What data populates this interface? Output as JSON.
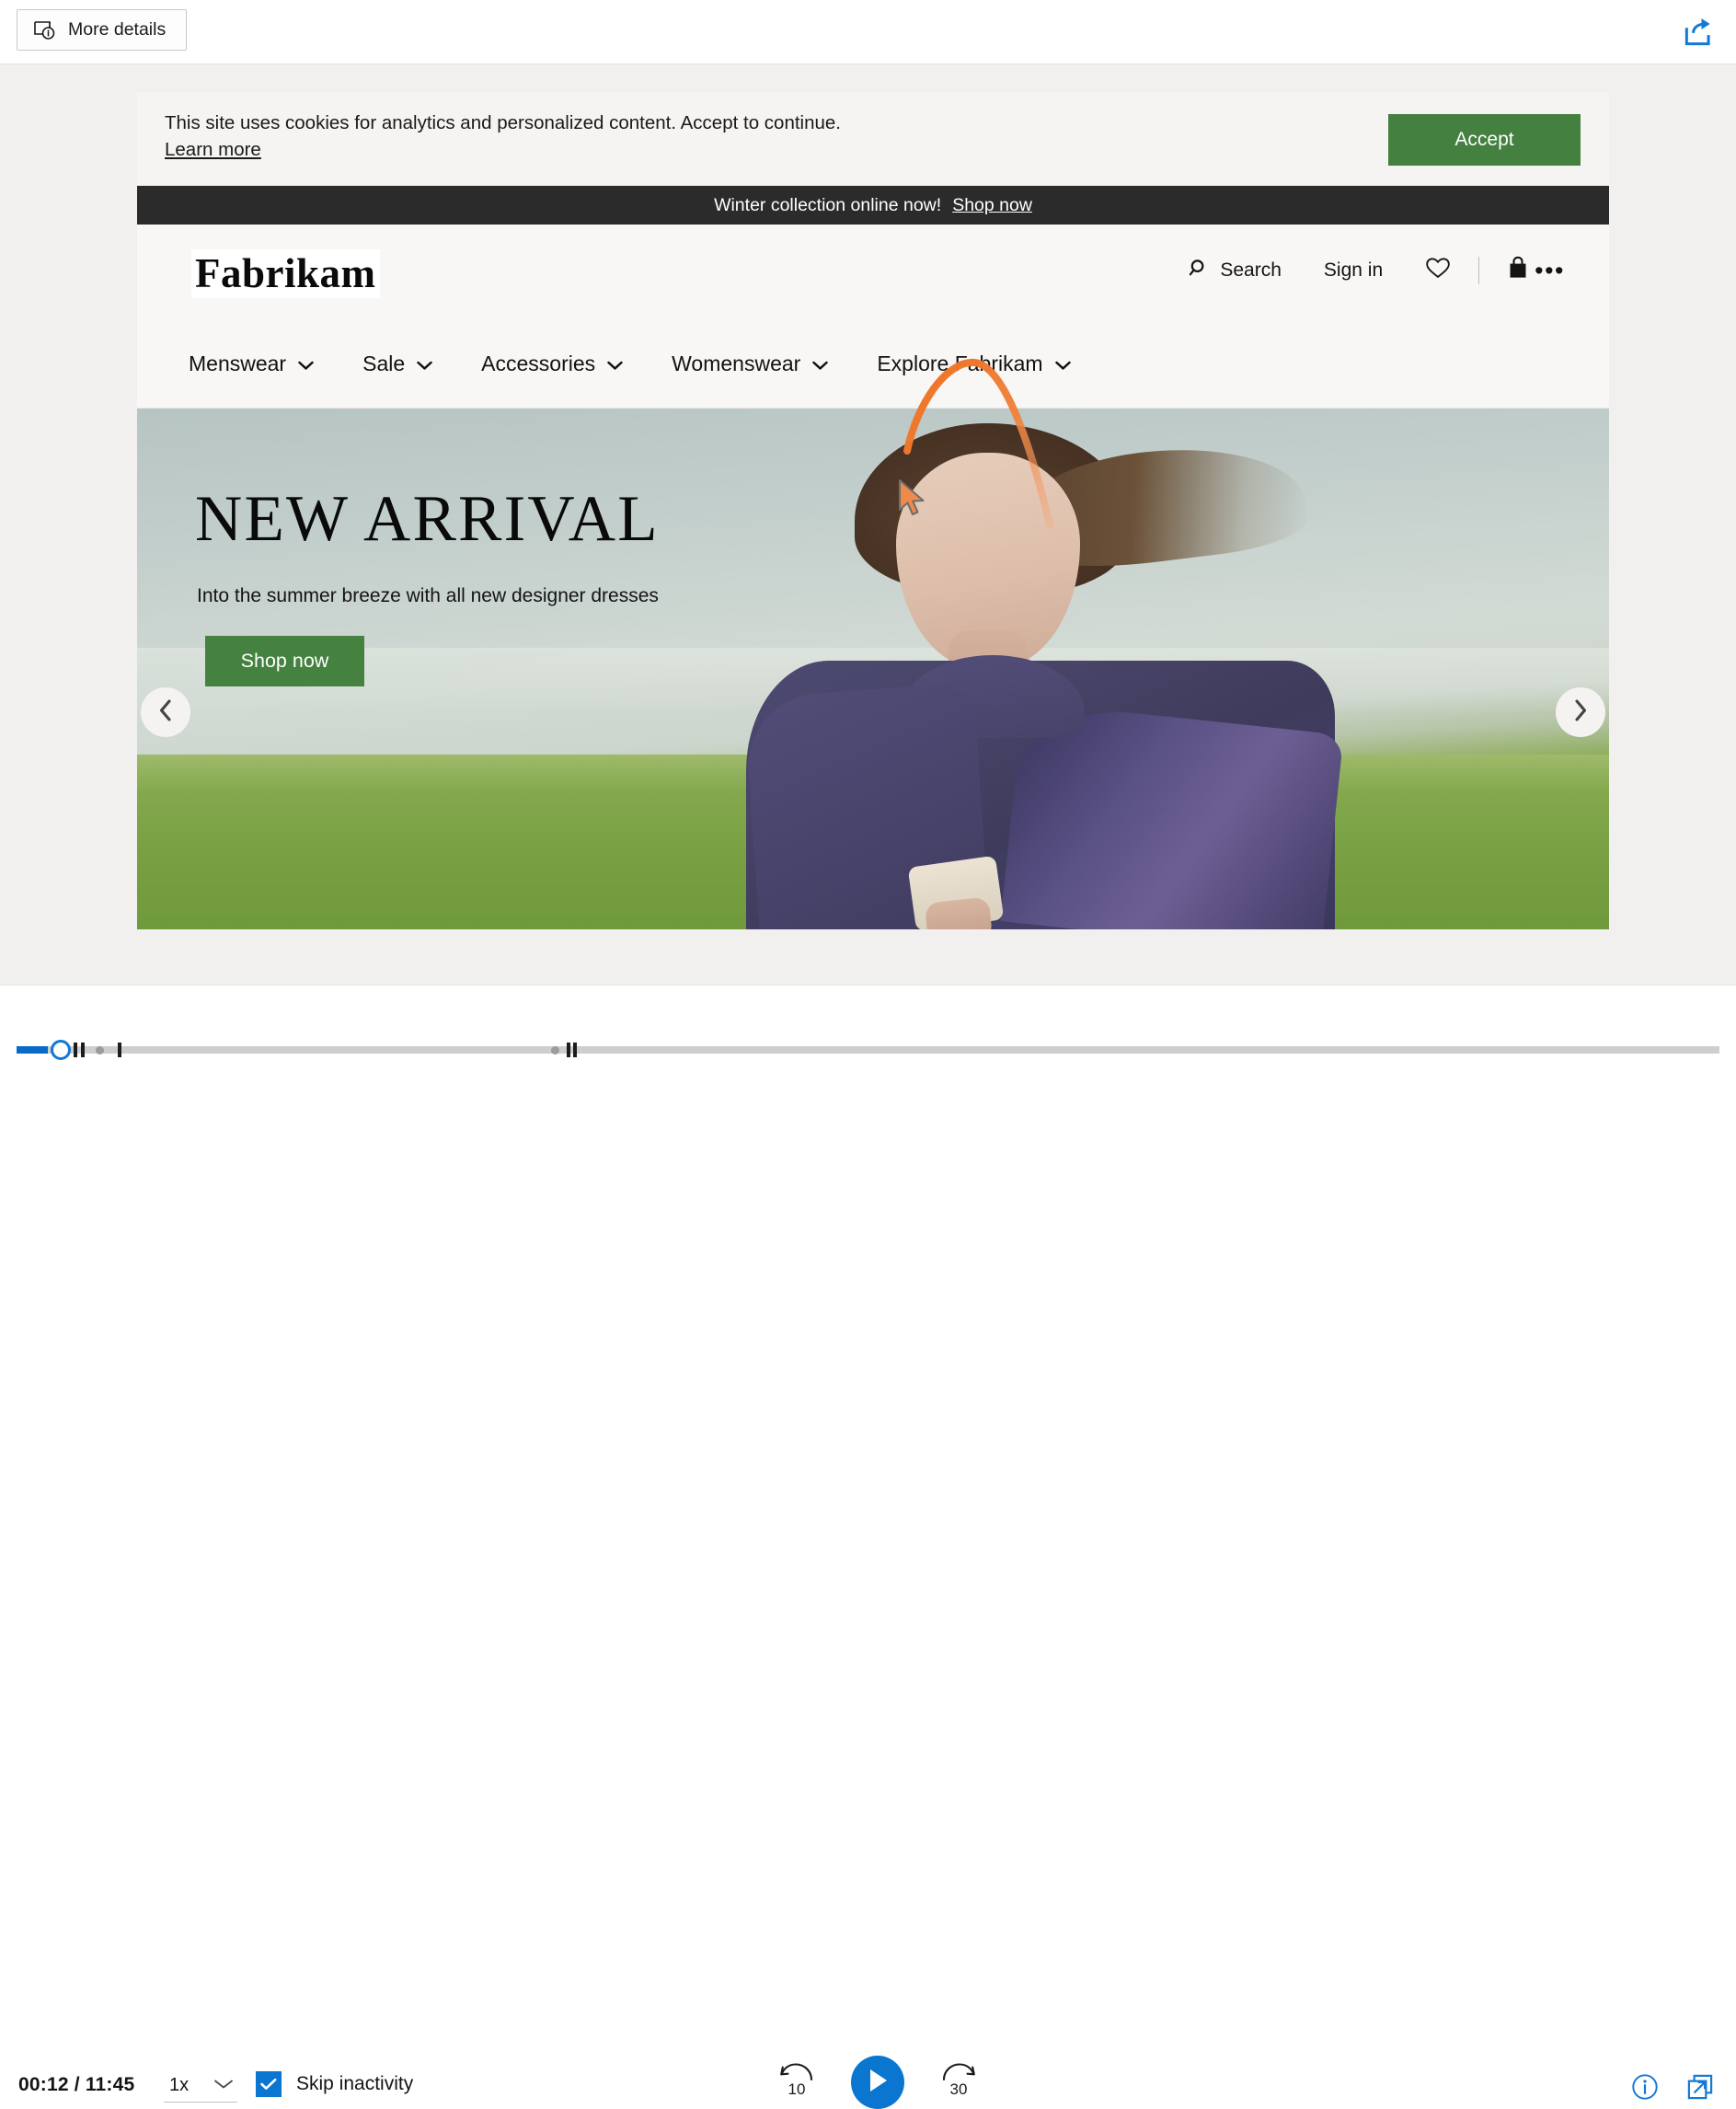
{
  "topbar": {
    "more_details_label": "More details",
    "more_details_icon": "details-info-icon",
    "share_icon": "share-icon"
  },
  "page": {
    "cookie_banner": {
      "message": "This site uses cookies for analytics and personalized content. Accept to continue.",
      "learn_more_label": "Learn more",
      "accept_label": "Accept",
      "accept_color": "#44803f"
    },
    "promo_bar": {
      "message": "Winter collection online now!",
      "link_label": "Shop now",
      "background": "#2b2b2b"
    },
    "header": {
      "logo_text": "Fabrikam",
      "search_label": "Search",
      "search_icon": "search-icon",
      "signin_label": "Sign in",
      "wishlist_icon": "heart-icon",
      "bag_icon": "shopping-bag-icon",
      "overflow_icon": "ellipsis-icon",
      "overflow_label": "•••"
    },
    "nav": {
      "items": [
        {
          "label": "Menswear",
          "icon": "chevron-down-icon"
        },
        {
          "label": "Sale",
          "icon": "chevron-down-icon"
        },
        {
          "label": "Accessories",
          "icon": "chevron-down-icon"
        },
        {
          "label": "Womenswear",
          "icon": "chevron-down-icon"
        },
        {
          "label": "Explore Fabrikam",
          "icon": "chevron-down-icon"
        }
      ]
    },
    "hero": {
      "title": "NEW ARRIVAL",
      "subtitle": "Into the summer breeze with all new designer dresses",
      "cta_label": "Shop now",
      "cta_color": "#45813f",
      "prev_icon": "chevron-left-icon",
      "next_icon": "chevron-right-icon"
    },
    "annotation": {
      "type": "cursor-trail",
      "color": "#ef7723",
      "target_label": "Explore Fabrikam"
    }
  },
  "player": {
    "current_time": "00:12",
    "total_time": "11:45",
    "time_display": "00:12 / 11:45",
    "speed_value": "1x",
    "speed_icon": "chevron-down-icon",
    "skip_inactivity_label": "Skip inactivity",
    "skip_inactivity_checked": true,
    "rewind_label": "10",
    "rewind_icon": "rewind-10-icon",
    "forward_label": "30",
    "forward_icon": "forward-30-icon",
    "play_icon": "play-icon",
    "info_icon": "info-icon",
    "popout_icon": "open-in-new-icon",
    "accent_color": "#0a76d0",
    "progress_percent": 1.7
  }
}
